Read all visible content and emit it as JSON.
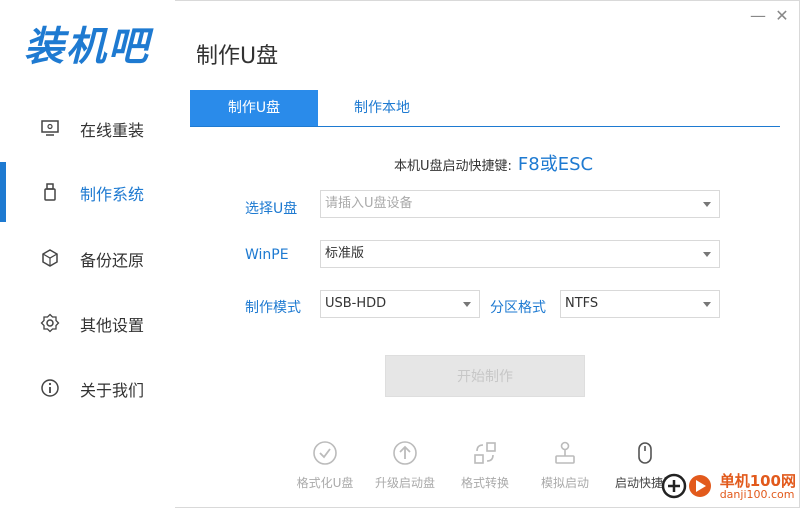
{
  "app": {
    "logo": "装机吧"
  },
  "window": {
    "minimize": "—",
    "close": "✕"
  },
  "sidebar": {
    "items": [
      {
        "label": "在线重装",
        "icon": "monitor-icon"
      },
      {
        "label": "制作系统",
        "icon": "usb-drive-icon",
        "active": true
      },
      {
        "label": "备份还原",
        "icon": "cube-icon"
      },
      {
        "label": "其他设置",
        "icon": "gear-icon"
      },
      {
        "label": "关于我们",
        "icon": "info-icon"
      }
    ]
  },
  "main": {
    "title": "制作U盘",
    "tabs": [
      {
        "label": "制作U盘",
        "active": true
      },
      {
        "label": "制作本地"
      }
    ],
    "shortcut": {
      "text": "本机U盘启动快捷键:",
      "keys": "F8或ESC"
    },
    "form": {
      "select_usb": {
        "label": "选择U盘",
        "placeholder": "请插入U盘设备"
      },
      "winpe": {
        "label": "WinPE",
        "value": "标准版"
      },
      "mode": {
        "label": "制作模式",
        "value": "USB-HDD"
      },
      "partition": {
        "label": "分区格式",
        "value": "NTFS"
      }
    },
    "start_button": "开始制作"
  },
  "tools": [
    {
      "label": "格式化U盘",
      "icon": "check-circle-icon"
    },
    {
      "label": "升级启动盘",
      "icon": "upload-circle-icon"
    },
    {
      "label": "格式转换",
      "icon": "convert-icon"
    },
    {
      "label": "模拟启动",
      "icon": "joystick-icon"
    },
    {
      "label": "启动快捷键",
      "icon": "mouse-icon"
    }
  ],
  "watermark": {
    "line1": "单机100网",
    "line2": "danji100.com"
  },
  "colors": {
    "accent": "#1e7ad1",
    "tab_active": "#2a8bea",
    "watermark": "#e25a1c"
  }
}
